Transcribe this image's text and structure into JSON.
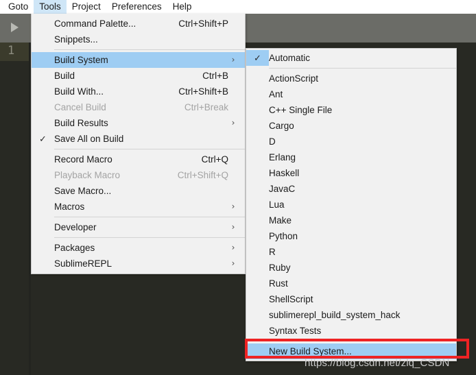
{
  "menubar": {
    "items": [
      {
        "label": "Goto",
        "active": false
      },
      {
        "label": "Tools",
        "active": true
      },
      {
        "label": "Project",
        "active": false
      },
      {
        "label": "Preferences",
        "active": false
      },
      {
        "label": "Help",
        "active": false
      }
    ]
  },
  "editor": {
    "line_number": "1",
    "run_icon": "play-triangle-icon",
    "background_color": "#282923",
    "toolbar_color": "#6b6c67"
  },
  "tools_menu": {
    "groups": [
      {
        "items": [
          {
            "label": "Command Palette...",
            "shortcut": "Ctrl+Shift+P",
            "checked": false,
            "submenu": false,
            "disabled": false,
            "highlighted": false
          },
          {
            "label": "Snippets...",
            "shortcut": "",
            "checked": false,
            "submenu": false,
            "disabled": false,
            "highlighted": false
          }
        ]
      },
      {
        "items": [
          {
            "label": "Build System",
            "shortcut": "",
            "checked": false,
            "submenu": true,
            "disabled": false,
            "highlighted": true
          },
          {
            "label": "Build",
            "shortcut": "Ctrl+B",
            "checked": false,
            "submenu": false,
            "disabled": false,
            "highlighted": false
          },
          {
            "label": "Build With...",
            "shortcut": "Ctrl+Shift+B",
            "checked": false,
            "submenu": false,
            "disabled": false,
            "highlighted": false
          },
          {
            "label": "Cancel Build",
            "shortcut": "Ctrl+Break",
            "checked": false,
            "submenu": false,
            "disabled": true,
            "highlighted": false
          },
          {
            "label": "Build Results",
            "shortcut": "",
            "checked": false,
            "submenu": true,
            "disabled": false,
            "highlighted": false
          },
          {
            "label": "Save All on Build",
            "shortcut": "",
            "checked": true,
            "submenu": false,
            "disabled": false,
            "highlighted": false
          }
        ]
      },
      {
        "items": [
          {
            "label": "Record Macro",
            "shortcut": "Ctrl+Q",
            "checked": false,
            "submenu": false,
            "disabled": false,
            "highlighted": false
          },
          {
            "label": "Playback Macro",
            "shortcut": "Ctrl+Shift+Q",
            "checked": false,
            "submenu": false,
            "disabled": true,
            "highlighted": false
          },
          {
            "label": "Save Macro...",
            "shortcut": "",
            "checked": false,
            "submenu": false,
            "disabled": false,
            "highlighted": false
          },
          {
            "label": "Macros",
            "shortcut": "",
            "checked": false,
            "submenu": true,
            "disabled": false,
            "highlighted": false
          }
        ]
      },
      {
        "items": [
          {
            "label": "Developer",
            "shortcut": "",
            "checked": false,
            "submenu": true,
            "disabled": false,
            "highlighted": false
          }
        ]
      },
      {
        "items": [
          {
            "label": "Packages",
            "shortcut": "",
            "checked": false,
            "submenu": true,
            "disabled": false,
            "highlighted": false
          },
          {
            "label": "SublimeREPL",
            "shortcut": "",
            "checked": false,
            "submenu": true,
            "disabled": false,
            "highlighted": false
          }
        ]
      }
    ]
  },
  "build_system_submenu": {
    "groups": [
      {
        "items": [
          {
            "label": "Automatic",
            "checked": true,
            "highlighted": false
          }
        ]
      },
      {
        "items": [
          {
            "label": "ActionScript",
            "checked": false,
            "highlighted": false
          },
          {
            "label": "Ant",
            "checked": false,
            "highlighted": false
          },
          {
            "label": "C++ Single File",
            "checked": false,
            "highlighted": false
          },
          {
            "label": "Cargo",
            "checked": false,
            "highlighted": false
          },
          {
            "label": "D",
            "checked": false,
            "highlighted": false
          },
          {
            "label": "Erlang",
            "checked": false,
            "highlighted": false
          },
          {
            "label": "Haskell",
            "checked": false,
            "highlighted": false
          },
          {
            "label": "JavaC",
            "checked": false,
            "highlighted": false
          },
          {
            "label": "Lua",
            "checked": false,
            "highlighted": false
          },
          {
            "label": "Make",
            "checked": false,
            "highlighted": false
          },
          {
            "label": "Python",
            "checked": false,
            "highlighted": false
          },
          {
            "label": "R",
            "checked": false,
            "highlighted": false
          },
          {
            "label": "Ruby",
            "checked": false,
            "highlighted": false
          },
          {
            "label": "Rust",
            "checked": false,
            "highlighted": false
          },
          {
            "label": "ShellScript",
            "checked": false,
            "highlighted": false
          },
          {
            "label": "sublimerepl_build_system_hack",
            "checked": false,
            "highlighted": false
          },
          {
            "label": "Syntax Tests",
            "checked": false,
            "highlighted": false
          }
        ]
      },
      {
        "items": [
          {
            "label": "New Build System...",
            "checked": false,
            "highlighted": true
          }
        ]
      }
    ]
  },
  "annotation": {
    "highlight_color": "#ee2324",
    "target_label": "New Build System..."
  },
  "watermark": {
    "text": "https://blog.csdn.net/zlq_CSDN"
  },
  "glyphs": {
    "check": "✓",
    "submenu_arrow": "›"
  }
}
